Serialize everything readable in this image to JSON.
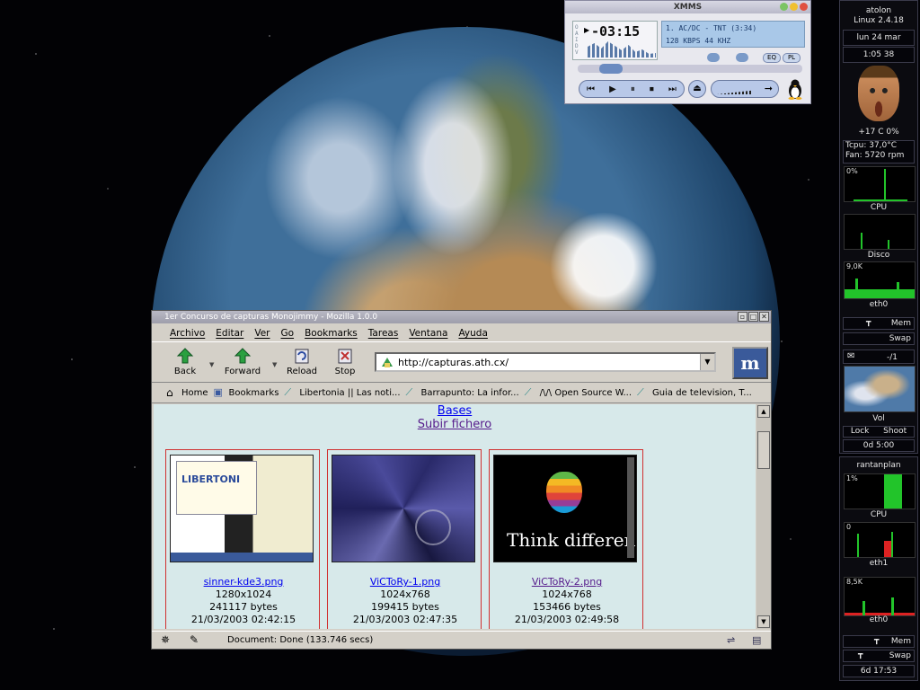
{
  "xmms": {
    "title": "XMMS",
    "time": "-03:15",
    "song": "1. AC/DC - TNT (3:34)",
    "bitrate": "128 KBPS  44 KHZ",
    "eq_label": "EQ",
    "pl_label": "PL"
  },
  "dock1": {
    "host": "atolon",
    "kernel": "Linux 2.4.18",
    "date": "lun 24 mar",
    "clock": "1:05 38",
    "temp_cpu_pct": "+17 C  0%",
    "tcpu": "Tcpu: 37,0°C",
    "fan": "Fan: 5720 rpm",
    "cpu_pct": "0%",
    "cpu_label": "CPU",
    "disk_label": "Disco",
    "net_rate": "9,0K",
    "net_label": "eth0",
    "mem_label": "Mem",
    "swap_label": "Swap",
    "mail": "-/1",
    "vol_label": "Vol",
    "lock_label": "Lock",
    "shoot_label": "Shoot",
    "uptime": "0d 5:00"
  },
  "dock2": {
    "host": "rantanplan",
    "cpu_pct": "1%",
    "cpu_label": "CPU",
    "eth1_val": "0",
    "eth1_label": "eth1",
    "eth0_val": "8,5K",
    "eth0_label": "eth0",
    "mem_label": "Mem",
    "swap_label": "Swap",
    "uptime": "6d 17:53"
  },
  "mozilla": {
    "title": "1er Concurso de capturas Monojimmy - Mozilla 1.0.0",
    "menu": [
      "Archivo",
      "Editar",
      "Ver",
      "Go",
      "Bookmarks",
      "Tareas",
      "Ventana",
      "Ayuda"
    ],
    "nav": {
      "back": "Back",
      "forward": "Forward",
      "reload": "Reload",
      "stop": "Stop"
    },
    "url": "http://capturas.ath.cx/",
    "bookmarks": [
      "Home",
      "Bookmarks",
      "Libertonia || Las noti...",
      "Barrapunto: La infor...",
      "/\\/\\ Open Source W...",
      "Guia de television, T..."
    ],
    "status": "Document: Done (133.746 secs)"
  },
  "page": {
    "link_bases": "Bases",
    "link_upload": "Subir fichero",
    "items": [
      {
        "file": "sinner-kde3.png",
        "dims": "1280x1024",
        "bytes": "241117 bytes",
        "date": "21/03/2003 02:42:15",
        "thumb_text": "LIBERTONI"
      },
      {
        "file": "ViCToRy-1.png",
        "dims": "1024x768",
        "bytes": "199415 bytes",
        "date": "21/03/2003 02:47:35",
        "thumb_text": ""
      },
      {
        "file": "ViCToRy-2.png",
        "dims": "1024x768",
        "bytes": "153466 bytes",
        "date": "21/03/2003 02:49:58",
        "thumb_text": "Think differen"
      }
    ]
  },
  "colors": {
    "accent_green": "#22c42a",
    "link_blue": "#0000ee",
    "link_visited": "#551a8b",
    "content_bg": "#d7e9ea"
  }
}
